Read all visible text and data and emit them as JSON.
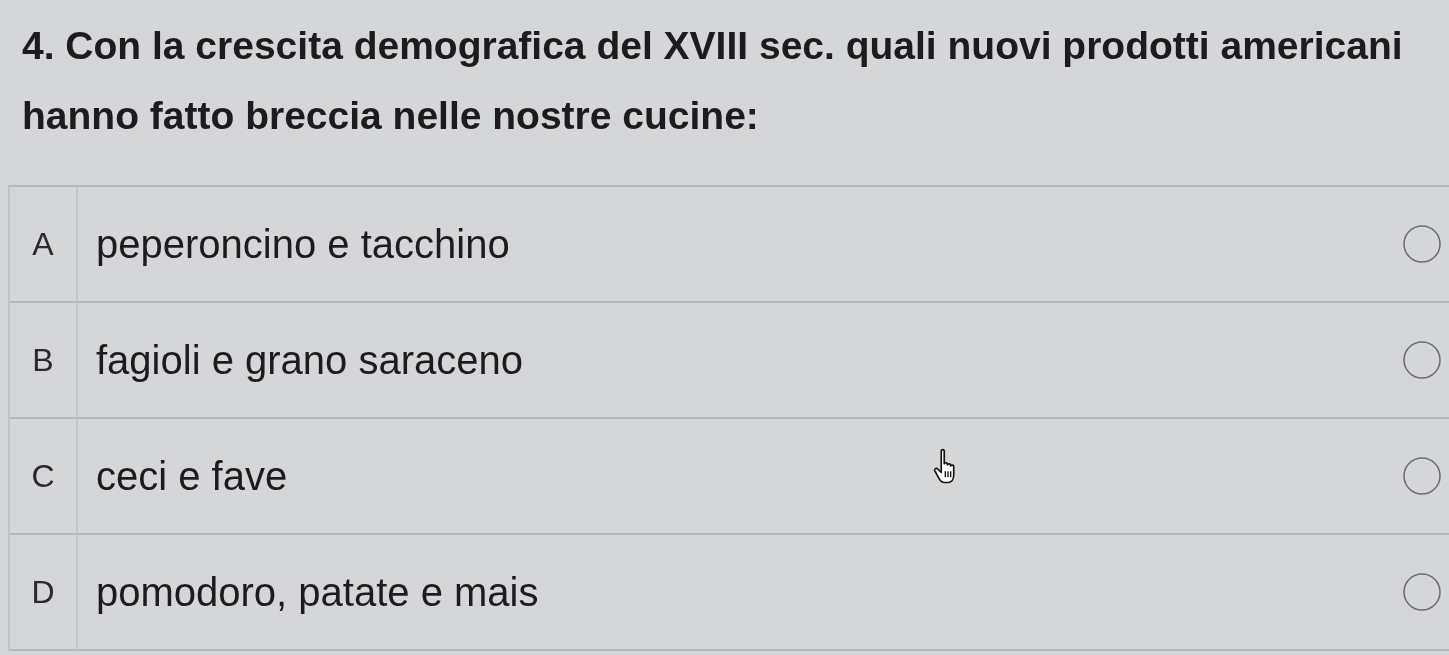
{
  "question": {
    "text": "4. Con la crescita demografica del XVIII sec. quali nuovi prodotti americani hanno fatto breccia nelle nostre cucine:"
  },
  "options": [
    {
      "letter": "A",
      "text": "peperoncino e tacchino",
      "selected": false
    },
    {
      "letter": "B",
      "text": "fagioli e grano saraceno",
      "selected": false
    },
    {
      "letter": "C",
      "text": "ceci e fave",
      "selected": false
    },
    {
      "letter": "D",
      "text": "pomodoro, patate e mais",
      "selected": false
    }
  ]
}
